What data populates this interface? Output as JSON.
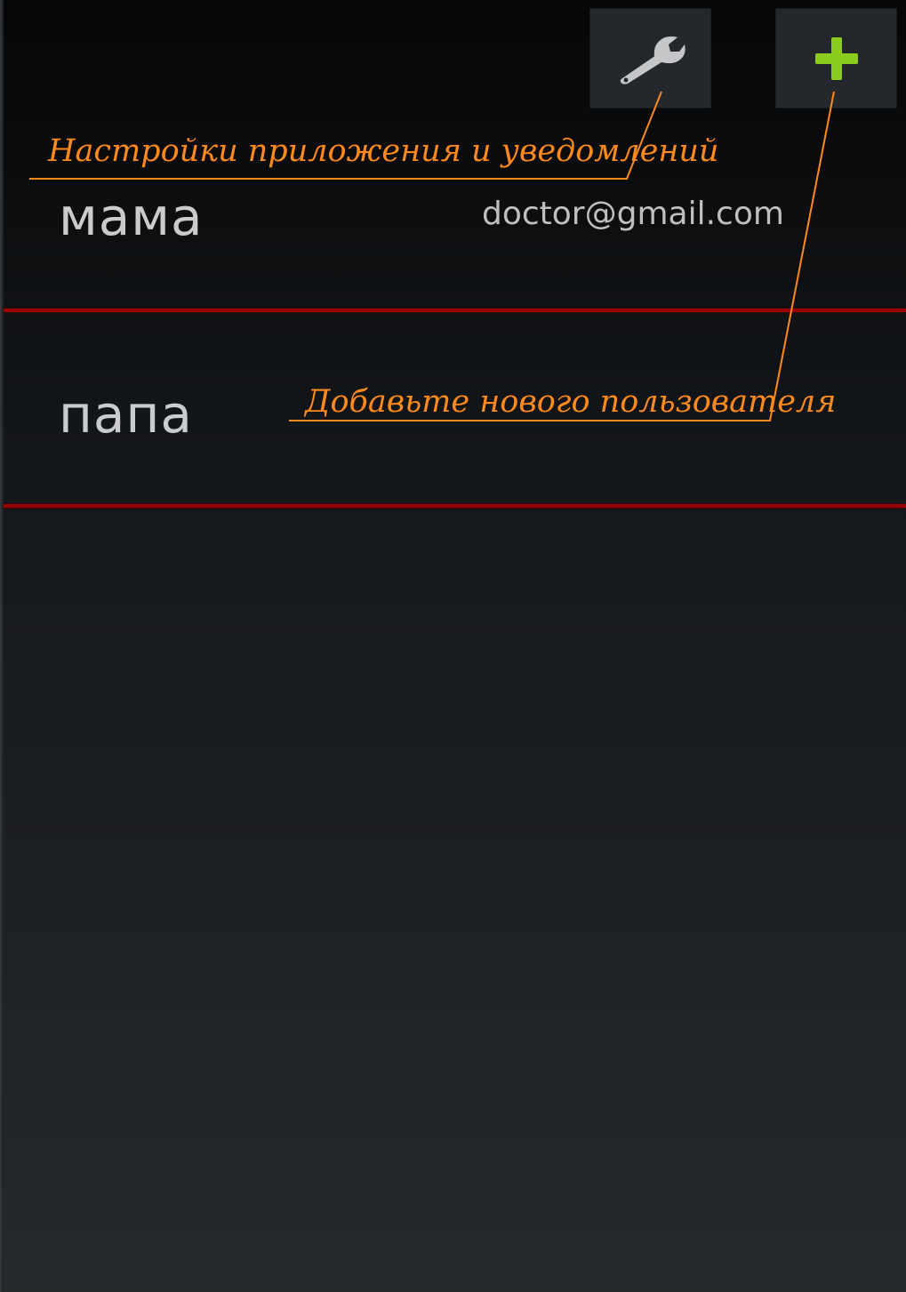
{
  "toolbar": {
    "settings_icon": "wrench-icon",
    "add_icon": "plus-icon",
    "add_icon_color": "#8ccc1e"
  },
  "users": [
    {
      "name": "мама",
      "email": "doctor@gmail.com"
    },
    {
      "name": "папа",
      "email": ""
    }
  ],
  "annotations": {
    "settings": "Настройки приложения и уведомлений",
    "add_user": "Добавьте нового пользователя",
    "color": "#ff8a1c"
  },
  "colors": {
    "divider": "#9a0000",
    "background_top": "#050607",
    "background_bottom": "#262a2f"
  }
}
